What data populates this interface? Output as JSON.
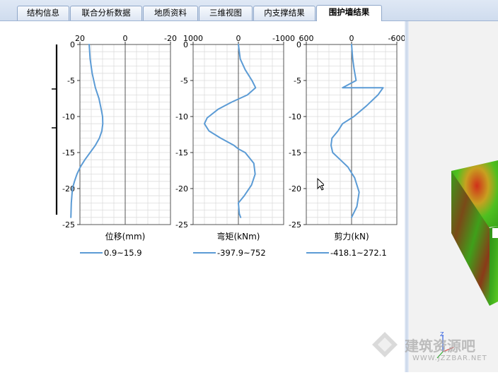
{
  "tabs": [
    {
      "label": "结构信息",
      "active": false
    },
    {
      "label": "联合分析数据",
      "active": false
    },
    {
      "label": "地质资料",
      "active": false
    },
    {
      "label": "三维视图",
      "active": false
    },
    {
      "label": "内支撑结果",
      "active": false
    },
    {
      "label": "围护墙结果",
      "active": true
    }
  ],
  "colors": {
    "curve": "#5b9bd5",
    "grid": "#dddddd",
    "axis": "#000000",
    "tabBorder": "#8fa7c9"
  },
  "watermark": {
    "text": "建筑资源吧",
    "url": "WWW.JZZBAR.NET"
  },
  "chart_data": [
    {
      "type": "line",
      "title": "",
      "xlabel": "位移(mm)",
      "ylabel": "",
      "xlim": [
        20,
        -20
      ],
      "ylim": [
        0,
        -25
      ],
      "xticks": [
        20,
        0,
        -20
      ],
      "yticks": [
        0,
        -5,
        -10,
        -15,
        -20,
        -25
      ],
      "legend": "0.9~15.9",
      "legend_position": "bottom",
      "grid": true,
      "series": [
        {
          "x": [
            15.9,
            15.5,
            14.6,
            13.2,
            11.6,
            10.6,
            10.0,
            9.9,
            10.3,
            11.4,
            13.2,
            15.5,
            17.8,
            19.8,
            21.3,
            22.4,
            23.3,
            23.8,
            24.0
          ],
          "y": [
            0,
            -2,
            -4,
            -6,
            -7.5,
            -9,
            -10,
            -11,
            -12,
            -13,
            -14,
            -15,
            -16,
            -17,
            -18,
            -19,
            -20,
            -22,
            -24
          ]
        }
      ]
    },
    {
      "type": "line",
      "title": "",
      "xlabel": "弯矩(kNm)",
      "ylabel": "",
      "xlim": [
        1000,
        -1000
      ],
      "ylim": [
        0,
        -25
      ],
      "xticks": [
        1000,
        0,
        -1000
      ],
      "yticks": [
        0,
        -5,
        -10,
        -15,
        -20,
        -25
      ],
      "legend": "-397.9~752",
      "legend_position": "bottom",
      "grid": true,
      "series": [
        {
          "x": [
            0,
            -40,
            -150,
            -300,
            -380,
            -200,
            150,
            450,
            690,
            750,
            650,
            390,
            100,
            0,
            -150,
            -340,
            -370,
            -290,
            -130,
            0,
            -20,
            -50
          ],
          "y": [
            0,
            -2,
            -3.5,
            -5,
            -6,
            -7,
            -8,
            -9,
            -10.2,
            -11,
            -12,
            -13,
            -14,
            -14.5,
            -15,
            -16.5,
            -18,
            -19.5,
            -21,
            -22,
            -23.5,
            -24
          ]
        }
      ]
    },
    {
      "type": "line",
      "title": "",
      "xlabel": "剪力(kN)",
      "ylabel": "",
      "xlim": [
        600,
        -600
      ],
      "ylim": [
        0,
        -25
      ],
      "xticks": [
        600,
        0,
        -600
      ],
      "yticks": [
        0,
        -5,
        -10,
        -15,
        -20,
        -25
      ],
      "legend": "-418.1~272.1",
      "legend_position": "bottom",
      "grid": true,
      "series": [
        {
          "x": [
            0,
            -15,
            -35,
            -60,
            120,
            -418.1,
            -350,
            -200,
            -30,
            120,
            180,
            260,
            272.1,
            250,
            150,
            50,
            -40,
            -100,
            -70,
            0
          ],
          "y": [
            0,
            -2,
            -3.5,
            -5,
            -6,
            -6,
            -7,
            -8.5,
            -10,
            -11,
            -12,
            -13,
            -14,
            -15,
            -16,
            -17,
            -18.5,
            -20.5,
            -22.5,
            -24
          ]
        }
      ]
    }
  ]
}
